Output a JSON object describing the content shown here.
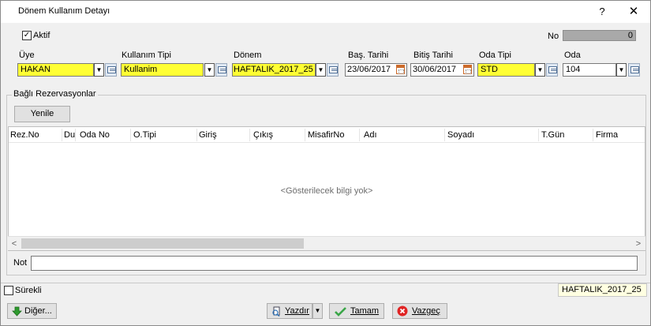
{
  "window": {
    "title": "Dönem Kullanım Detayı",
    "help_glyph": "?",
    "close_glyph": "✕"
  },
  "header": {
    "aktif_label": "Aktif",
    "aktif_checked": true,
    "no_label": "No",
    "no_value": "0"
  },
  "fields": {
    "uye": {
      "label": "Üye",
      "value": "HAKAN"
    },
    "kullanim_tipi": {
      "label": "Kullanım Tipi",
      "value": "Kullanim"
    },
    "donem": {
      "label": "Dönem",
      "value": "HAFTALIK_2017_25"
    },
    "bas_tarihi": {
      "label": "Baş. Tarihi",
      "value": "23/06/2017"
    },
    "bitis_tarihi": {
      "label": "Bitiş Tarihi",
      "value": "30/06/2017"
    },
    "oda_tipi": {
      "label": "Oda Tipi",
      "value": "STD"
    },
    "oda": {
      "label": "Oda",
      "value": "104"
    }
  },
  "reservations": {
    "group_title": "Bağlı Rezervasyonlar",
    "refresh_label": "Yenile",
    "columns": [
      "Rez.No",
      "Du",
      "Oda No",
      "O.Tipi",
      "Giriş",
      "Çıkış",
      "MisafirNo",
      "Adı",
      "Soyadı",
      "T.Gün",
      "Firma"
    ],
    "empty_text": "<Gösterilecek bilgi yok>"
  },
  "not_label": "Not",
  "not_value": "",
  "status": {
    "surekli_label": "Sürekli",
    "surekli_checked": false,
    "period_value": "HAFTALIK_2017_25"
  },
  "buttons": {
    "diger": "Diğer...",
    "yazdir": "Yazdır",
    "tamam": "Tamam",
    "vazgec": "Vazgeç"
  },
  "colors": {
    "required_bg": "#ffff33",
    "selection_blue": "#0078d7"
  },
  "icons": [
    "check-icon",
    "dropdown-arrow-icon",
    "lookup-icon",
    "calendar-icon",
    "arrow-down-green-icon",
    "print-icon",
    "ok-check-icon",
    "cancel-x-icon",
    "scroll-left-icon",
    "scroll-right-icon"
  ]
}
